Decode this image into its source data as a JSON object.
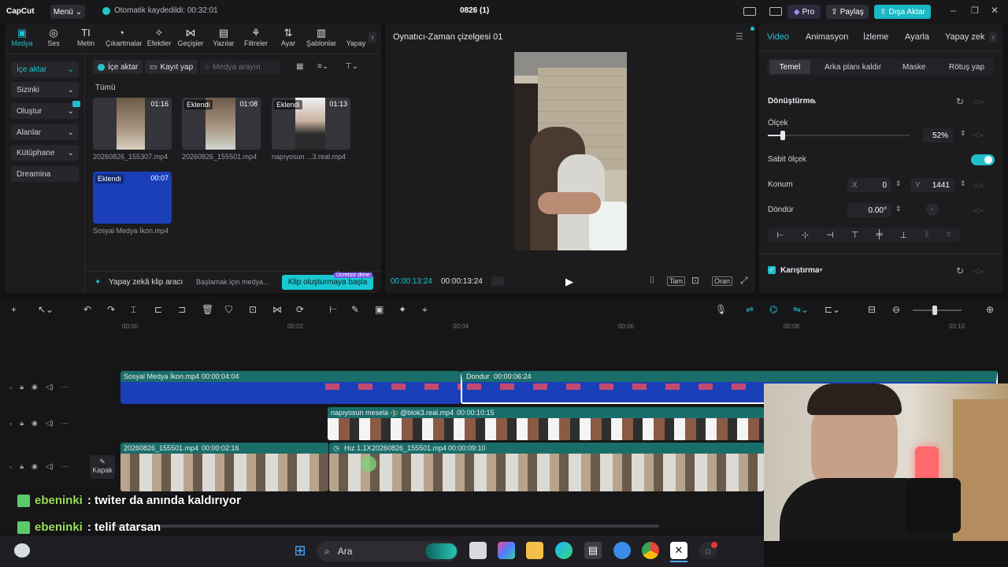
{
  "topbar": {
    "logo": "CapCut",
    "menu_label": "Menü",
    "autosave": "Otomatik kaydedildi: 00:32:01",
    "project_title": "0826 (1)",
    "pro_label": "Pro",
    "share_label": "Paylaş",
    "export_label": "Dışa Aktar"
  },
  "tools": [
    {
      "label": "Medya",
      "icon": "media-icon",
      "glyph": "▣"
    },
    {
      "label": "Ses",
      "icon": "audio-icon",
      "glyph": "◎"
    },
    {
      "label": "Metin",
      "icon": "text-icon",
      "glyph": "TI"
    },
    {
      "label": "Çıkartmalar",
      "icon": "sticker-icon",
      "glyph": "◔"
    },
    {
      "label": "Efektler",
      "icon": "effects-icon",
      "glyph": "✧"
    },
    {
      "label": "Geçişler",
      "icon": "transitions-icon",
      "glyph": "⋈"
    },
    {
      "label": "Yazılar",
      "icon": "captions-icon",
      "glyph": "▤"
    },
    {
      "label": "Filtreler",
      "icon": "filters-icon",
      "glyph": "⚘"
    },
    {
      "label": "Ayar",
      "icon": "adjust-icon",
      "glyph": "⇅"
    },
    {
      "label": "Şablonlar",
      "icon": "templates-icon",
      "glyph": "▥"
    },
    {
      "label": "Yapay",
      "icon": "ai-icon",
      "glyph": ""
    }
  ],
  "sidebar": {
    "items": [
      {
        "label": "İçe aktar"
      },
      {
        "label": "Sizinki"
      },
      {
        "label": "Oluştur"
      },
      {
        "label": "Alanlar"
      },
      {
        "label": "Kütüphane"
      },
      {
        "label": "Dreamina"
      }
    ]
  },
  "media_panel": {
    "import_btn": "İçe aktar",
    "record_btn": "Kayıt yap",
    "search_placeholder": "Medya arayın",
    "filter_all": "Tümü",
    "items": [
      {
        "name": "20260826_155307.mp4",
        "duration": "01:16",
        "tag": ""
      },
      {
        "name": "20260826_155501.mp4",
        "duration": "01:08",
        "tag": "Eklendi"
      },
      {
        "name": "napıyosun ...3.real.mp4",
        "duration": "01:13",
        "tag": "Eklendi"
      },
      {
        "name": "Sosyal Medya İkon.mp4",
        "duration": "00:07",
        "tag": "Eklendi"
      }
    ],
    "ai_clip_label": "Yapay zekâ klip aracı",
    "ai_clip_hint": "Başlamak için medya...",
    "ai_clip_btn": "Klip oluşturmaya başla",
    "ai_clip_badge": "Ücretsiz dene"
  },
  "player": {
    "title": "Oynatıcı-Zaman çizelgesi 01",
    "current_time": "00:00:13:24",
    "total_time": "00:00:13:24",
    "full_label": "Tam",
    "ratio_label": "Oran"
  },
  "inspector": {
    "tabs": [
      "Video",
      "Animasyon",
      "İzleme",
      "Ayarla",
      "Yapay zek"
    ],
    "subtabs": [
      "Temel",
      "Arka planı kaldır",
      "Maske",
      "Rötuş yap"
    ],
    "section_transform": "Dönüştürme",
    "scale_label": "Ölçek",
    "scale_value": "52%",
    "scale_level": 0.52,
    "uniform_scale_label": "Sabit ölçek",
    "position_label": "Konum",
    "x_label": "X",
    "x_value": "0",
    "y_label": "Y",
    "y_value": "1441",
    "rotate_label": "Döndür",
    "rotate_value": "0.00°",
    "blend_label": "Karıştırma"
  },
  "timeline": {
    "ruler": [
      "00:00",
      "00:02",
      "00:04",
      "00:06",
      "00:08",
      "00:10"
    ],
    "cover_label": "Kapak",
    "clips": {
      "c1_name": "Sosyal Medya İkon.mp4",
      "c1_dur": "00:00:04:04",
      "c2_name": "Dondur",
      "c2_dur": "00:00:06:24",
      "c3_name": "napıyosun mesela -)",
      "c3_user": "@blok3.real.mp4",
      "c3_dur": "00:00:10:15",
      "c4_name": "20260826_155501.mp4",
      "c4_dur": "00:00:02:16",
      "c5_speed": "Hız 1.1X",
      "c5_name": "20260826_155501.mp4",
      "c5_dur": "00:00:09:10"
    }
  },
  "chat": [
    {
      "user": "ebeninki",
      "text": ": twiter da anında kaldırıyor"
    },
    {
      "user": "ebeninki",
      "text": ": telif atarsan"
    }
  ],
  "taskbar": {
    "search_label": "Ara"
  },
  "colors": {
    "accent": "#1fc0cc",
    "export_bg": "#19b8c4",
    "clip_blue": "#1a3fb8",
    "clip_teal": "#1a6e6a"
  }
}
